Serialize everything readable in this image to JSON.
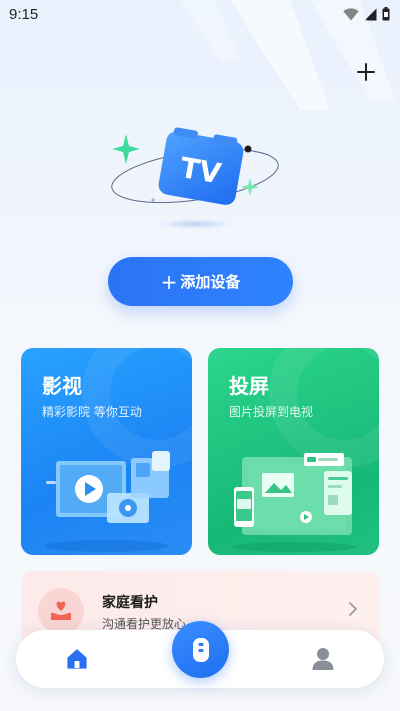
{
  "status_bar": {
    "time": "9:15"
  },
  "hero": {
    "tv_text": "TV"
  },
  "add_device": {
    "plus": "+",
    "label": "添加设备"
  },
  "cards": {
    "movie": {
      "title": "影视",
      "subtitle": "精彩影院 等你互动"
    },
    "cast": {
      "title": "投屏",
      "subtitle": "图片投屏到电视"
    }
  },
  "family": {
    "title": "家庭看护",
    "subtitle": "沟通看护更放心"
  },
  "colors": {
    "accent": "#2a74f6",
    "movie_card": "#1b84f4",
    "cast_card": "#17b876",
    "family_bg": "#fdeaea"
  },
  "icons": {
    "add": "plus-icon",
    "home": "home-icon",
    "remote": "remote-icon",
    "profile": "profile-icon",
    "family": "heart-hand-icon",
    "chevron": "chevron-right-icon"
  }
}
